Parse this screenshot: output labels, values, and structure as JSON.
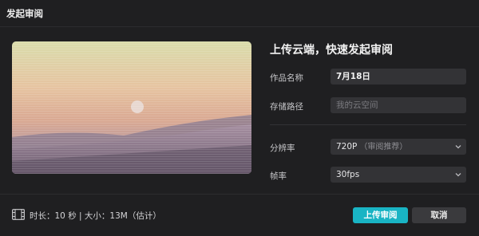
{
  "dialog": {
    "title": "发起审阅"
  },
  "form": {
    "heading": "上传云端，快速发起审阅",
    "name": {
      "label": "作品名称",
      "value": "7月18日"
    },
    "path": {
      "label": "存储路径",
      "placeholder": "我的云空间"
    },
    "resolution": {
      "label": "分辨率",
      "value": "720P",
      "hint": "（审阅推荐）"
    },
    "framerate": {
      "label": "帧率",
      "value": "30fps"
    }
  },
  "footer": {
    "summary": "时长：10 秒 | 大小：13M（估计）",
    "upload_label": "上传审阅",
    "cancel_label": "取消"
  },
  "colors": {
    "accent": "#19b4c4",
    "background": "#1f1f21",
    "field": "#333336"
  },
  "icons": {
    "duration": "film-icon",
    "dropdown": "chevron-down-icon"
  }
}
